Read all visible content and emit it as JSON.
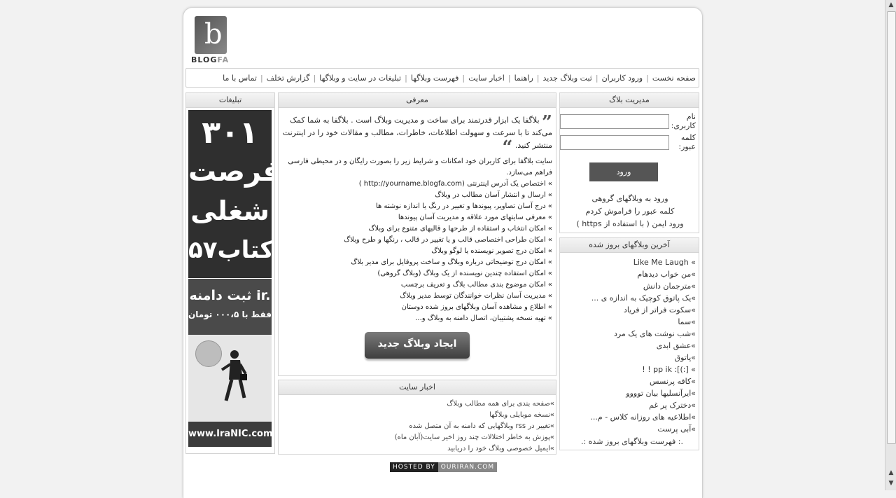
{
  "logo": {
    "letter": "b",
    "text_main": "BLOG",
    "text_accent": "FA"
  },
  "nav": {
    "items": [
      "صفحه نخست",
      "ورود کاربران",
      "ثبت وبلاگ جدید",
      "راهنما",
      "اخبار سایت",
      "فهرست وبلاگها",
      "تبلیغات در سایت و وبلاگها",
      "گزارش تخلف",
      "تماس با ما"
    ],
    "separator": "|"
  },
  "mgmt": {
    "title": "مدیریت بلاگ",
    "username_label": "نام کاربری:",
    "password_label": "کلمه عبور:",
    "login_label": "ورود",
    "links": [
      "ورود به وبلاگهای گروهی",
      "کلمه عبور را فراموش کردم",
      "ورود ایمن ( با استفاده از https )"
    ]
  },
  "updated": {
    "title": "آخرین وبلاگهای بروز شده",
    "items": [
      "» Like Me Laugh",
      "»من خواب دیدهام",
      "»مترجمان دانش",
      "»یک پاتوق کوچیک به اندازه ی ...",
      "»سکوت فراتر از فریاد",
      "»سما",
      "»شب نوشت های یک مرد",
      "»عشق ابدی",
      "»پاتوق",
      "» [:)]: pp ik ! !",
      "»کافه پرنسس",
      "»ایرآنسلیها بیان توووو",
      "»دخترک پر غم",
      "»اطلاعیه های روزانه کلاس - م...",
      "»آبی پرست"
    ],
    "footer": ".: فهرست وبلاگهای بروز شده :."
  },
  "intro": {
    "title": "معرفی",
    "quote": "بلاگفا یک ابزار قدرتمند برای ساخت و مدیریت وبلاگ است . بلاگفا به شما کمک می‌کند تا با سرعت و سهولت اطلاعات، خاطرات، مطالب و مقالات خود را در اینترنت منتشر کنید.",
    "description": "سایت بلاگفا برای کاربران خود امکانات و شرایط زیر را بصورت رایگان و در محیطی فارسی فراهم می‌سازد.",
    "features": [
      "» اختصاص یک آدرس اینترنتی (http://yourname.blogfa.com )",
      "» ارسال و انتشار آسان مطالب در وبلاگ",
      "» درج آسان تصاویر، پیوندها و تغییر در رنگ یا اندازه نوشته ها",
      "» معرفی سایتهای مورد علاقه و مدیریت آسان پیوندها",
      "» امکان انتخاب و استفاده از طرحها و قالبهای متنوع برای وبلاگ",
      "» امکان طراحی اختصاصی قالب و یا تغییر در قالب ، رنگها و طرح وبلاگ",
      "» امکان درج تصویر نویسنده یا لوگو وبلاگ",
      "» امکان درج توضیحاتی درباره وبلاگ و ساخت پروفایل برای مدیر بلاگ",
      "» امکان استفاده چندین نویسنده از یک وبلاگ (وبلاگ گروهی)",
      "» امکان موضوع بندی مطالب بلاگ و تعریف برچسب",
      "» مدیریت آسان نظرات خوانندگان توسط مدیر وبلاگ",
      "» اطلاع و مشاهده آسان وبلاگهای بروز شده دوستان",
      "» تهیه نسخه پشتیبان، اتصال دامنه به وبلاگ و..."
    ],
    "create_label": "ایجاد وبلاگ جدید"
  },
  "news": {
    "title": "اخبار سایت",
    "items": [
      "»صفحه بندی برای همه مطالب وبلاگ",
      "»نسخه موبایلی وبلاگها",
      "»تغییر در rss وبلاگهایی که دامنه به آن متصل شده",
      "»پوزش به خاطر اختلالات چند روز اخیر سایت(آبان ماه)",
      "»ایمیل خصوصی وبلاگ خود را دریابید"
    ]
  },
  "ads": {
    "title": "تبلیغات",
    "ad1": [
      "۳۰۱",
      "فرصت",
      "شغلی",
      "کتاب۵۷"
    ],
    "ad2": {
      "title": "ثبت دامنه ir.",
      "price": "فقط با ۰۰۰،۵ تومان",
      "url": "www.IraNIC.com"
    }
  },
  "hosted": {
    "label": "HOSTED BY",
    "host": "OURIRAN.COM"
  },
  "colors": {
    "button": "#555555",
    "page_bg": "#f2f2f2",
    "box_border": "#d4d4d4"
  }
}
